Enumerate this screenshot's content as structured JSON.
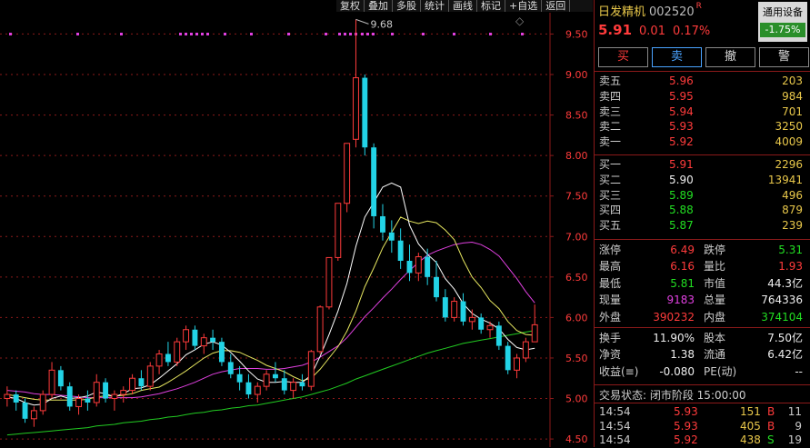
{
  "toolbar": [
    "复权",
    "叠加",
    "多股",
    "统计",
    "画线",
    "标记",
    "+自选",
    "返回"
  ],
  "chart": {
    "y_ticks": [
      "9.50",
      "9.00",
      "8.50",
      "8.00",
      "7.50",
      "7.00",
      "6.50",
      "6.00",
      "5.50",
      "5.00",
      "4.50"
    ],
    "high_label": "9.68",
    "colors": {
      "up": "#ff3b3b",
      "down": "#22d3e6",
      "ma5": "#ffffff",
      "ma10": "#e8e860",
      "ma20": "#e040e0",
      "ma60": "#22cc22",
      "grid": "#8b1a1a"
    }
  },
  "chart_data": {
    "type": "candlestick",
    "y_range": [
      4.4,
      9.92
    ],
    "candles": [
      [
        5.0,
        5.15,
        4.9,
        5.05
      ],
      [
        5.05,
        5.1,
        4.85,
        4.95
      ],
      [
        4.95,
        5.0,
        4.7,
        4.75
      ],
      [
        4.75,
        4.9,
        4.65,
        4.85
      ],
      [
        4.85,
        5.1,
        4.8,
        5.05
      ],
      [
        5.05,
        5.45,
        5.0,
        5.35
      ],
      [
        5.35,
        5.4,
        5.1,
        5.15
      ],
      [
        5.15,
        5.2,
        4.85,
        4.9
      ],
      [
        4.9,
        5.05,
        4.8,
        5.0
      ],
      [
        5.0,
        5.1,
        4.85,
        4.95
      ],
      [
        4.95,
        5.3,
        4.9,
        5.2
      ],
      [
        5.2,
        5.25,
        4.95,
        5.0
      ],
      [
        5.0,
        5.1,
        4.85,
        5.05
      ],
      [
        5.05,
        5.15,
        4.95,
        5.1
      ],
      [
        5.1,
        5.3,
        5.05,
        5.25
      ],
      [
        5.25,
        5.35,
        5.1,
        5.15
      ],
      [
        5.15,
        5.45,
        5.1,
        5.4
      ],
      [
        5.4,
        5.6,
        5.3,
        5.55
      ],
      [
        5.55,
        5.7,
        5.4,
        5.45
      ],
      [
        5.45,
        5.75,
        5.4,
        5.7
      ],
      [
        5.7,
        5.9,
        5.6,
        5.85
      ],
      [
        5.85,
        5.9,
        5.6,
        5.65
      ],
      [
        5.65,
        5.8,
        5.55,
        5.75
      ],
      [
        5.75,
        5.85,
        5.6,
        5.7
      ],
      [
        5.7,
        5.75,
        5.4,
        5.45
      ],
      [
        5.45,
        5.55,
        5.25,
        5.3
      ],
      [
        5.3,
        5.4,
        5.1,
        5.2
      ],
      [
        5.2,
        5.3,
        5.0,
        5.05
      ],
      [
        5.05,
        5.2,
        4.95,
        5.15
      ],
      [
        5.15,
        5.35,
        5.1,
        5.3
      ],
      [
        5.3,
        5.45,
        5.2,
        5.25
      ],
      [
        5.25,
        5.35,
        5.05,
        5.1
      ],
      [
        5.1,
        5.25,
        5.0,
        5.2
      ],
      [
        5.2,
        5.3,
        5.1,
        5.15
      ],
      [
        5.15,
        5.6,
        5.1,
        5.58
      ],
      [
        5.58,
        6.15,
        5.55,
        6.13
      ],
      [
        6.13,
        6.74,
        6.1,
        6.74
      ],
      [
        6.74,
        7.41,
        6.7,
        7.41
      ],
      [
        7.41,
        8.15,
        7.3,
        8.15
      ],
      [
        8.2,
        9.68,
        8.1,
        8.96
      ],
      [
        8.96,
        9.0,
        8.0,
        8.1
      ],
      [
        8.1,
        8.15,
        7.1,
        7.25
      ],
      [
        7.25,
        7.4,
        6.95,
        7.05
      ],
      [
        7.05,
        7.2,
        6.8,
        6.95
      ],
      [
        6.95,
        7.1,
        6.6,
        6.7
      ],
      [
        6.7,
        6.9,
        6.45,
        6.55
      ],
      [
        6.55,
        6.8,
        6.45,
        6.75
      ],
      [
        6.75,
        6.85,
        6.4,
        6.5
      ],
      [
        6.5,
        6.7,
        6.2,
        6.25
      ],
      [
        6.25,
        6.35,
        5.95,
        6.0
      ],
      [
        6.0,
        6.25,
        5.95,
        6.2
      ],
      [
        6.2,
        6.3,
        5.9,
        5.95
      ],
      [
        5.95,
        6.1,
        5.85,
        6.0
      ],
      [
        6.0,
        6.05,
        5.8,
        5.85
      ],
      [
        5.85,
        5.95,
        5.75,
        5.9
      ],
      [
        5.9,
        5.95,
        5.6,
        5.65
      ],
      [
        5.65,
        5.7,
        5.3,
        5.35
      ],
      [
        5.35,
        5.55,
        5.25,
        5.5
      ],
      [
        5.5,
        5.75,
        5.45,
        5.7
      ],
      [
        5.7,
        6.16,
        5.81,
        5.91
      ]
    ],
    "ma5": [
      5.02,
      5.0,
      4.95,
      4.92,
      4.93,
      5.0,
      5.03,
      5.0,
      5.01,
      5.03,
      5.08,
      5.06,
      5.02,
      5.06,
      5.12,
      5.13,
      5.17,
      5.25,
      5.34,
      5.43,
      5.54,
      5.6,
      5.67,
      5.7,
      5.66,
      5.57,
      5.46,
      5.34,
      5.24,
      5.2,
      5.2,
      5.21,
      5.2,
      5.2,
      5.29,
      5.52,
      5.79,
      6.08,
      6.42,
      6.88,
      7.24,
      7.42,
      7.61,
      7.66,
      7.61,
      7.14,
      6.91,
      6.78,
      6.68,
      6.48,
      6.35,
      6.17,
      6.05,
      5.98,
      5.93,
      5.86,
      5.73,
      5.63,
      5.6,
      5.62
    ],
    "ma10": [
      5.05,
      5.03,
      5.01,
      4.99,
      4.98,
      4.98,
      4.98,
      4.98,
      4.98,
      4.99,
      5.02,
      5.03,
      5.03,
      5.04,
      5.06,
      5.1,
      5.12,
      5.14,
      5.2,
      5.27,
      5.34,
      5.42,
      5.5,
      5.56,
      5.59,
      5.59,
      5.57,
      5.52,
      5.47,
      5.41,
      5.37,
      5.33,
      5.27,
      5.22,
      5.25,
      5.36,
      5.5,
      5.64,
      5.83,
      6.08,
      6.38,
      6.61,
      6.86,
      7.05,
      7.24,
      7.19,
      7.16,
      7.19,
      7.17,
      7.08,
      6.96,
      6.71,
      6.5,
      6.37,
      6.21,
      6.11,
      5.95,
      5.84,
      5.79,
      5.78
    ],
    "ma20": [
      5.1,
      5.09,
      5.08,
      5.06,
      5.05,
      5.05,
      5.04,
      5.03,
      5.02,
      5.01,
      5.01,
      5.01,
      5.01,
      5.01,
      5.01,
      5.02,
      5.04,
      5.06,
      5.09,
      5.12,
      5.16,
      5.2,
      5.25,
      5.3,
      5.33,
      5.35,
      5.37,
      5.37,
      5.37,
      5.36,
      5.36,
      5.37,
      5.39,
      5.41,
      5.45,
      5.51,
      5.58,
      5.65,
      5.75,
      5.88,
      6.01,
      6.12,
      6.24,
      6.35,
      6.47,
      6.58,
      6.68,
      6.77,
      6.82,
      6.86,
      6.9,
      6.92,
      6.93,
      6.9,
      6.84,
      6.76,
      6.62,
      6.48,
      6.32,
      6.18
    ],
    "ma60": [
      4.55,
      4.56,
      4.57,
      4.58,
      4.59,
      4.6,
      4.61,
      4.62,
      4.63,
      4.64,
      4.66,
      4.67,
      4.68,
      4.7,
      4.71,
      4.72,
      4.74,
      4.75,
      4.77,
      4.78,
      4.8,
      4.82,
      4.83,
      4.85,
      4.86,
      4.88,
      4.89,
      4.91,
      4.92,
      4.94,
      4.96,
      4.98,
      5.0,
      5.02,
      5.05,
      5.08,
      5.11,
      5.15,
      5.19,
      5.24,
      5.28,
      5.32,
      5.36,
      5.4,
      5.44,
      5.48,
      5.52,
      5.56,
      5.59,
      5.62,
      5.65,
      5.68,
      5.7,
      5.72,
      5.74,
      5.76,
      5.78,
      5.8,
      5.82,
      5.84
    ]
  },
  "panel": {
    "name": "日发精机",
    "code": "002520",
    "r_mark": "R",
    "device_label": "通用设备",
    "device_change": "-1.75%",
    "price": "5.91",
    "change": "0.01",
    "change_pct": "0.17%",
    "buttons": {
      "buy": "买",
      "sell": "卖",
      "cancel": "撤",
      "alert": "警"
    },
    "sells": [
      {
        "label": "卖五",
        "price": "5.96",
        "vol": "203",
        "cls": "red"
      },
      {
        "label": "卖四",
        "price": "5.95",
        "vol": "984",
        "cls": "red"
      },
      {
        "label": "卖三",
        "price": "5.94",
        "vol": "701",
        "cls": "red"
      },
      {
        "label": "卖二",
        "price": "5.93",
        "vol": "3250",
        "cls": "red"
      },
      {
        "label": "卖一",
        "price": "5.92",
        "vol": "4009",
        "cls": "red"
      }
    ],
    "buys": [
      {
        "label": "买一",
        "price": "5.91",
        "vol": "2296",
        "cls": "red"
      },
      {
        "label": "买二",
        "price": "5.90",
        "vol": "13941",
        "cls": "white"
      },
      {
        "label": "买三",
        "price": "5.89",
        "vol": "496",
        "cls": "green"
      },
      {
        "label": "买四",
        "price": "5.88",
        "vol": "879",
        "cls": "green"
      },
      {
        "label": "买五",
        "price": "5.87",
        "vol": "239",
        "cls": "green"
      }
    ],
    "stats": [
      {
        "k1": "涨停",
        "v1": "6.49",
        "c1": "red",
        "k2": "跌停",
        "v2": "5.31",
        "c2": "green"
      },
      {
        "k1": "最高",
        "v1": "6.16",
        "c1": "red",
        "k2": "量比",
        "v2": "1.93",
        "c2": "red"
      },
      {
        "k1": "最低",
        "v1": "5.81",
        "c1": "green",
        "k2": "市值",
        "v2": "44.3亿",
        "c2": "white"
      },
      {
        "k1": "现量",
        "v1": "9183",
        "c1": "mag",
        "k2": "总量",
        "v2": "764336",
        "c2": "white"
      },
      {
        "k1": "外盘",
        "v1": "390232",
        "c1": "red",
        "k2": "内盘",
        "v2": "374104",
        "c2": "green"
      }
    ],
    "stats2": [
      {
        "k1": "换手",
        "v1": "11.90%",
        "c1": "white",
        "k2": "股本",
        "v2": "7.50亿",
        "c2": "white"
      },
      {
        "k1": "净资",
        "v1": "1.38",
        "c1": "white",
        "k2": "流通",
        "v2": "6.42亿",
        "c2": "white"
      },
      {
        "k1": "收益(≡)",
        "v1": "-0.080",
        "c1": "white",
        "k2": "PE(动)",
        "v2": "--",
        "c2": "white"
      }
    ],
    "status": "交易状态: 闭市阶段 15:00:00",
    "ticks": [
      {
        "t": "14:54",
        "p": "5.93",
        "v": "151",
        "s": "B",
        "n": "11"
      },
      {
        "t": "14:54",
        "p": "5.93",
        "v": "405",
        "s": "B",
        "n": "9"
      },
      {
        "t": "14:54",
        "p": "5.92",
        "v": "438",
        "s": "S",
        "n": "19"
      }
    ]
  }
}
